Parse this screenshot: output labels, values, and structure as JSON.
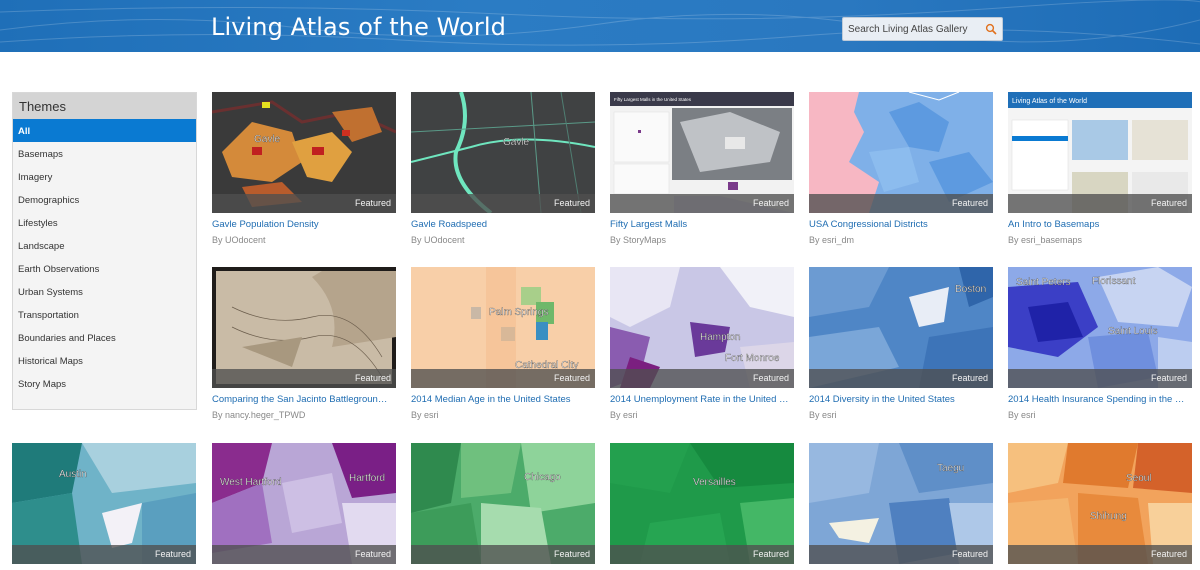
{
  "header": {
    "title": "Living Atlas of the World",
    "search_placeholder": "Search Living Atlas Gallery"
  },
  "sidebar": {
    "heading": "Themes",
    "items": [
      {
        "label": "All",
        "active": true
      },
      {
        "label": "Basemaps"
      },
      {
        "label": "Imagery"
      },
      {
        "label": "Demographics"
      },
      {
        "label": "Lifestyles"
      },
      {
        "label": "Landscape"
      },
      {
        "label": "Earth Observations"
      },
      {
        "label": "Urban Systems"
      },
      {
        "label": "Transportation"
      },
      {
        "label": "Boundaries and Places"
      },
      {
        "label": "Historical Maps"
      },
      {
        "label": "Story Maps"
      }
    ]
  },
  "badge": "Featured",
  "cards": [
    {
      "title": "Gavle Population Density",
      "by": "By UOdocent",
      "map_label": "Gavle"
    },
    {
      "title": "Gavle Roadspeed",
      "by": "By UOdocent",
      "map_label": "Gavle"
    },
    {
      "title": "Fifty Largest Malls",
      "by": "By StoryMaps",
      "map_label": "Fifty Largest Malls in the United States"
    },
    {
      "title": "USA Congressional Districts",
      "by": "By esri_dm",
      "map_label": ""
    },
    {
      "title": "An Intro to Basemaps",
      "by": "By esri_basemaps",
      "map_label": "Living Atlas of the World"
    },
    {
      "title": "Comparing the San Jacinto Battleground a ...",
      "by": "By nancy.heger_TPWD",
      "map_label": ""
    },
    {
      "title": "2014 Median Age in the United States",
      "by": "By esri",
      "map_label": "Palm Springs",
      "map_label2": "Cathedral City"
    },
    {
      "title": "2014 Unemployment Rate in the United Sta ...",
      "by": "By esri",
      "map_label": "Hampton",
      "map_label2": "Fort Monroe"
    },
    {
      "title": "2014 Diversity in the United States",
      "by": "By esri",
      "map_label": "Boston"
    },
    {
      "title": "2014 Health Insurance Spending in the Un ...",
      "by": "By esri",
      "map_label": "Saint Louis",
      "map_label2": "Saint Peters",
      "map_label3": "Florissant"
    },
    {
      "title": "",
      "by": "",
      "map_label": "Austin"
    },
    {
      "title": "",
      "by": "",
      "map_label": "West Hartford",
      "map_label2": "Hartford"
    },
    {
      "title": "",
      "by": "",
      "map_label": "Chicago"
    },
    {
      "title": "",
      "by": "",
      "map_label": "Versailles"
    },
    {
      "title": "",
      "by": "",
      "map_label": "Taegu"
    },
    {
      "title": "",
      "by": "",
      "map_label": "Seoul",
      "map_label2": "Shihung"
    }
  ],
  "colors": {
    "header": "#2a78c0",
    "active": "#0a7ad2",
    "link": "#1f6db2"
  }
}
